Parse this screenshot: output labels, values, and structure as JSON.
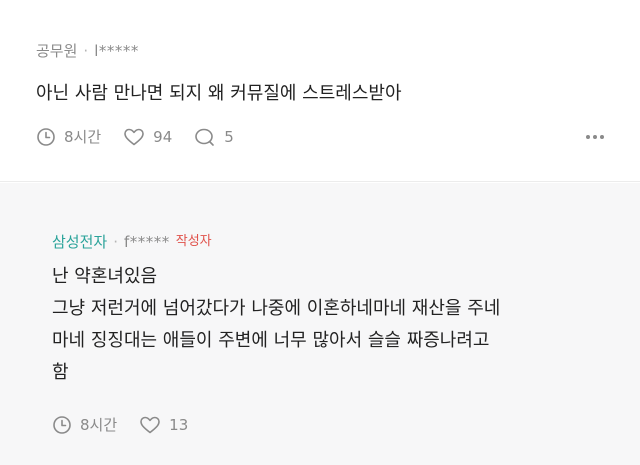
{
  "comments": [
    {
      "author": "공무원",
      "separator": "·",
      "masked_id": "l*****",
      "text_lines": [
        "아닌 사람 만나면 되지 왜 커뮤질에 스트레스받아"
      ],
      "time": "8시간",
      "likes": "94",
      "replies": "5"
    },
    {
      "author": "삼성전자",
      "separator": "·",
      "masked_id": "f*****",
      "badge": "작성자",
      "text_lines": [
        "난 약혼녀있음",
        "그냥 저런거에 넘어갔다가 나중에 이혼하네마네 재산을 주네",
        "마네 징징대는 애들이 주변에 너무 많아서 슬슬 짜증나려고",
        "함"
      ],
      "time": "8시간",
      "likes": "13"
    }
  ],
  "colors": {
    "reply_author": "#2ba39a",
    "writer_badge": "#e0524b",
    "meta_gray": "#8a8a8a",
    "reply_background": "#f7f7f8"
  },
  "icons": [
    "clock-icon",
    "heart-icon",
    "comment-bubble-icon",
    "more-dots-icon"
  ]
}
